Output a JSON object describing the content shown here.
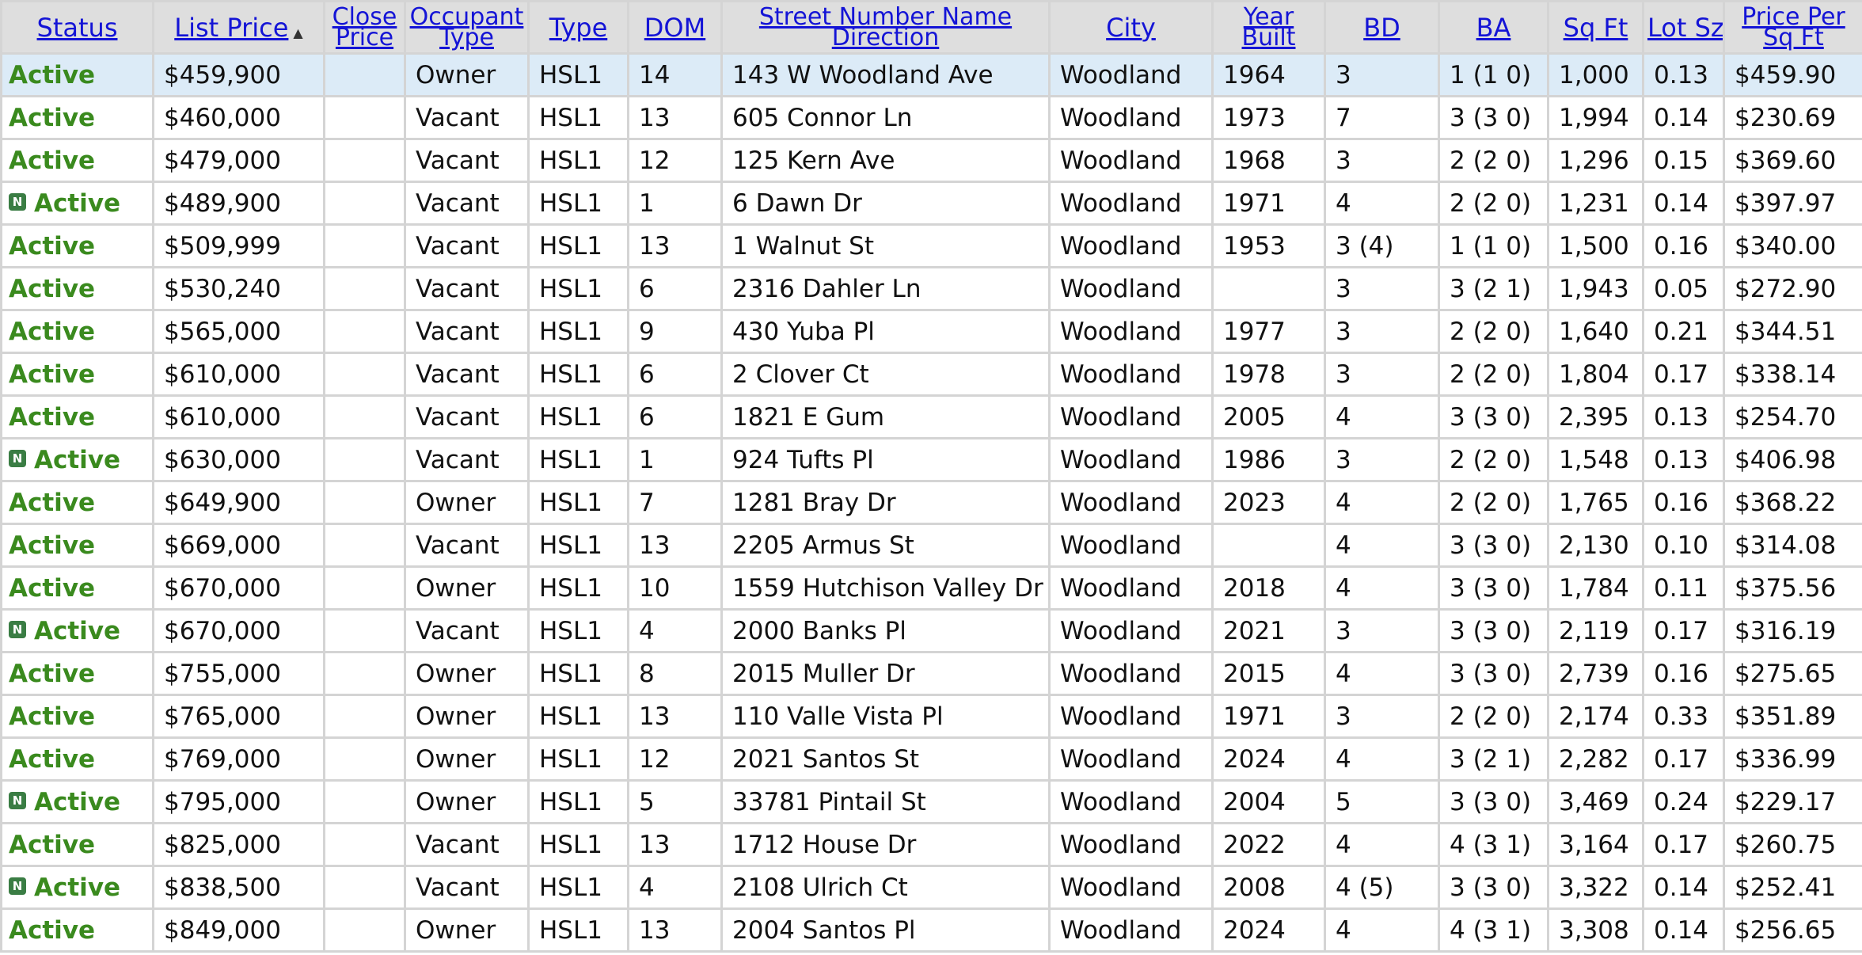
{
  "columns": [
    {
      "label": "Status"
    },
    {
      "label": "List Price",
      "sort_icon": "sort-ascending-icon"
    },
    {
      "label_lines": [
        "Close",
        "Price"
      ]
    },
    {
      "label_lines": [
        "Occupant",
        "Type"
      ]
    },
    {
      "label": "Type"
    },
    {
      "label": "DOM"
    },
    {
      "label_lines": [
        "Street Number Name",
        "Direction"
      ]
    },
    {
      "label": "City"
    },
    {
      "label_lines": [
        "Year",
        "Built"
      ]
    },
    {
      "label": "BD"
    },
    {
      "label": "BA"
    },
    {
      "label": "Sq Ft"
    },
    {
      "label": "Lot Sz"
    },
    {
      "label_lines": [
        "Price Per",
        "Sq Ft"
      ]
    }
  ],
  "badge_text": "N",
  "selected_row": 0,
  "rows": [
    {
      "status": "Active",
      "new": false,
      "list_price": "$459,900",
      "close_price": "",
      "occupant": "Owner",
      "type": "HSL1",
      "dom": "14",
      "address": "143 W Woodland Ave",
      "city": "Woodland",
      "year_built": "1964",
      "bd": "3",
      "ba": "1 (1 0)",
      "sqft": "1,000",
      "lot": "0.13",
      "ppsf": "$459.90"
    },
    {
      "status": "Active",
      "new": false,
      "list_price": "$460,000",
      "close_price": "",
      "occupant": "Vacant",
      "type": "HSL1",
      "dom": "13",
      "address": "605 Connor Ln",
      "city": "Woodland",
      "year_built": "1973",
      "bd": "7",
      "ba": "3 (3 0)",
      "sqft": "1,994",
      "lot": "0.14",
      "ppsf": "$230.69"
    },
    {
      "status": "Active",
      "new": false,
      "list_price": "$479,000",
      "close_price": "",
      "occupant": "Vacant",
      "type": "HSL1",
      "dom": "12",
      "address": "125 Kern Ave",
      "city": "Woodland",
      "year_built": "1968",
      "bd": "3",
      "ba": "2 (2 0)",
      "sqft": "1,296",
      "lot": "0.15",
      "ppsf": "$369.60"
    },
    {
      "status": "Active",
      "new": true,
      "list_price": "$489,900",
      "close_price": "",
      "occupant": "Vacant",
      "type": "HSL1",
      "dom": "1",
      "address": "6 Dawn Dr",
      "city": "Woodland",
      "year_built": "1971",
      "bd": "4",
      "ba": "2 (2 0)",
      "sqft": "1,231",
      "lot": "0.14",
      "ppsf": "$397.97"
    },
    {
      "status": "Active",
      "new": false,
      "list_price": "$509,999",
      "close_price": "",
      "occupant": "Vacant",
      "type": "HSL1",
      "dom": "13",
      "address": "1 Walnut St",
      "city": "Woodland",
      "year_built": "1953",
      "bd": "3 (4)",
      "ba": "1 (1 0)",
      "sqft": "1,500",
      "lot": "0.16",
      "ppsf": "$340.00"
    },
    {
      "status": "Active",
      "new": false,
      "list_price": "$530,240",
      "close_price": "",
      "occupant": "Vacant",
      "type": "HSL1",
      "dom": "6",
      "address": "2316 Dahler Ln",
      "city": "Woodland",
      "year_built": "",
      "bd": "3",
      "ba": "3 (2 1)",
      "sqft": "1,943",
      "lot": "0.05",
      "ppsf": "$272.90"
    },
    {
      "status": "Active",
      "new": false,
      "list_price": "$565,000",
      "close_price": "",
      "occupant": "Vacant",
      "type": "HSL1",
      "dom": "9",
      "address": "430 Yuba Pl",
      "city": "Woodland",
      "year_built": "1977",
      "bd": "3",
      "ba": "2 (2 0)",
      "sqft": "1,640",
      "lot": "0.21",
      "ppsf": "$344.51"
    },
    {
      "status": "Active",
      "new": false,
      "list_price": "$610,000",
      "close_price": "",
      "occupant": "Vacant",
      "type": "HSL1",
      "dom": "6",
      "address": "2 Clover Ct",
      "city": "Woodland",
      "year_built": "1978",
      "bd": "3",
      "ba": "2 (2 0)",
      "sqft": "1,804",
      "lot": "0.17",
      "ppsf": "$338.14"
    },
    {
      "status": "Active",
      "new": false,
      "list_price": "$610,000",
      "close_price": "",
      "occupant": "Vacant",
      "type": "HSL1",
      "dom": "6",
      "address": "1821 E Gum",
      "city": "Woodland",
      "year_built": "2005",
      "bd": "4",
      "ba": "3 (3 0)",
      "sqft": "2,395",
      "lot": "0.13",
      "ppsf": "$254.70"
    },
    {
      "status": "Active",
      "new": true,
      "list_price": "$630,000",
      "close_price": "",
      "occupant": "Vacant",
      "type": "HSL1",
      "dom": "1",
      "address": "924 Tufts Pl",
      "city": "Woodland",
      "year_built": "1986",
      "bd": "3",
      "ba": "2 (2 0)",
      "sqft": "1,548",
      "lot": "0.13",
      "ppsf": "$406.98"
    },
    {
      "status": "Active",
      "new": false,
      "list_price": "$649,900",
      "close_price": "",
      "occupant": "Owner",
      "type": "HSL1",
      "dom": "7",
      "address": "1281 Bray Dr",
      "city": "Woodland",
      "year_built": "2023",
      "bd": "4",
      "ba": "2 (2 0)",
      "sqft": "1,765",
      "lot": "0.16",
      "ppsf": "$368.22"
    },
    {
      "status": "Active",
      "new": false,
      "list_price": "$669,000",
      "close_price": "",
      "occupant": "Vacant",
      "type": "HSL1",
      "dom": "13",
      "address": "2205 Armus St",
      "city": "Woodland",
      "year_built": "",
      "bd": "4",
      "ba": "3 (3 0)",
      "sqft": "2,130",
      "lot": "0.10",
      "ppsf": "$314.08"
    },
    {
      "status": "Active",
      "new": false,
      "list_price": "$670,000",
      "close_price": "",
      "occupant": "Owner",
      "type": "HSL1",
      "dom": "10",
      "address": "1559 Hutchison Valley Dr",
      "city": "Woodland",
      "year_built": "2018",
      "bd": "4",
      "ba": "3 (3 0)",
      "sqft": "1,784",
      "lot": "0.11",
      "ppsf": "$375.56"
    },
    {
      "status": "Active",
      "new": true,
      "list_price": "$670,000",
      "close_price": "",
      "occupant": "Vacant",
      "type": "HSL1",
      "dom": "4",
      "address": "2000 Banks Pl",
      "city": "Woodland",
      "year_built": "2021",
      "bd": "3",
      "ba": "3 (3 0)",
      "sqft": "2,119",
      "lot": "0.17",
      "ppsf": "$316.19"
    },
    {
      "status": "Active",
      "new": false,
      "list_price": "$755,000",
      "close_price": "",
      "occupant": "Owner",
      "type": "HSL1",
      "dom": "8",
      "address": "2015 Muller Dr",
      "city": "Woodland",
      "year_built": "2015",
      "bd": "4",
      "ba": "3 (3 0)",
      "sqft": "2,739",
      "lot": "0.16",
      "ppsf": "$275.65"
    },
    {
      "status": "Active",
      "new": false,
      "list_price": "$765,000",
      "close_price": "",
      "occupant": "Owner",
      "type": "HSL1",
      "dom": "13",
      "address": "110 Valle Vista Pl",
      "city": "Woodland",
      "year_built": "1971",
      "bd": "3",
      "ba": "2 (2 0)",
      "sqft": "2,174",
      "lot": "0.33",
      "ppsf": "$351.89"
    },
    {
      "status": "Active",
      "new": false,
      "list_price": "$769,000",
      "close_price": "",
      "occupant": "Owner",
      "type": "HSL1",
      "dom": "12",
      "address": "2021 Santos St",
      "city": "Woodland",
      "year_built": "2024",
      "bd": "4",
      "ba": "3 (2 1)",
      "sqft": "2,282",
      "lot": "0.17",
      "ppsf": "$336.99"
    },
    {
      "status": "Active",
      "new": true,
      "list_price": "$795,000",
      "close_price": "",
      "occupant": "Owner",
      "type": "HSL1",
      "dom": "5",
      "address": "33781 Pintail St",
      "city": "Woodland",
      "year_built": "2004",
      "bd": "5",
      "ba": "3 (3 0)",
      "sqft": "3,469",
      "lot": "0.24",
      "ppsf": "$229.17"
    },
    {
      "status": "Active",
      "new": false,
      "list_price": "$825,000",
      "close_price": "",
      "occupant": "Vacant",
      "type": "HSL1",
      "dom": "13",
      "address": "1712 House Dr",
      "city": "Woodland",
      "year_built": "2022",
      "bd": "4",
      "ba": "4 (3 1)",
      "sqft": "3,164",
      "lot": "0.17",
      "ppsf": "$260.75"
    },
    {
      "status": "Active",
      "new": true,
      "list_price": "$838,500",
      "close_price": "",
      "occupant": "Vacant",
      "type": "HSL1",
      "dom": "4",
      "address": "2108 Ulrich Ct",
      "city": "Woodland",
      "year_built": "2008",
      "bd": "4 (5)",
      "ba": "3 (3 0)",
      "sqft": "3,322",
      "lot": "0.14",
      "ppsf": "$252.41"
    },
    {
      "status": "Active",
      "new": false,
      "list_price": "$849,000",
      "close_price": "",
      "occupant": "Owner",
      "type": "HSL1",
      "dom": "13",
      "address": "2004 Santos Pl",
      "city": "Woodland",
      "year_built": "2024",
      "bd": "4",
      "ba": "4 (3 1)",
      "sqft": "3,308",
      "lot": "0.14",
      "ppsf": "$256.65"
    }
  ]
}
